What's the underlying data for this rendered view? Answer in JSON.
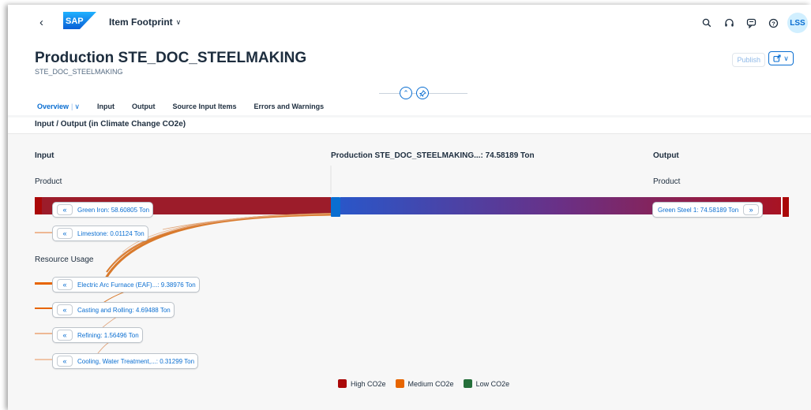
{
  "shell": {
    "logo_text": "SAP",
    "app_title": "Item Footprint",
    "avatar_initials": "LSS"
  },
  "header": {
    "title": "Production STE_DOC_STEELMAKING",
    "subtitle": "STE_DOC_STEELMAKING",
    "publish_label": "Publish"
  },
  "tabs": [
    {
      "label": "Overview"
    },
    {
      "label": "Input"
    },
    {
      "label": "Output"
    },
    {
      "label": "Source Input Items"
    },
    {
      "label": "Errors and Warnings"
    }
  ],
  "section": {
    "title": "Input / Output (in Climate Change CO2e)",
    "input_heading": "Input",
    "center_heading": "Production STE_DOC_STEELMAKING...: 74.58189 Ton",
    "output_heading": "Output",
    "input_product_label": "Product",
    "output_product_label": "Product",
    "resource_usage_label": "Resource Usage"
  },
  "inputs": {
    "products": [
      {
        "label": "Green Iron: 58.60805 Ton",
        "value": 58.60805,
        "level": "high"
      },
      {
        "label": "Limestone: 0.01124 Ton",
        "value": 0.01124,
        "level": "medium"
      }
    ],
    "resources": [
      {
        "label": "Electric Arc Furnace (EAF)...: 9.38976 Ton",
        "value": 9.38976,
        "level": "medium"
      },
      {
        "label": "Casting and Rolling: 4.69488 Ton",
        "value": 4.69488,
        "level": "medium"
      },
      {
        "label": "Refining: 1.56496 Ton",
        "value": 1.56496,
        "level": "medium"
      },
      {
        "label": "Cooling, Water Treatment,...: 0.31299 Ton",
        "value": 0.31299,
        "level": "medium"
      }
    ]
  },
  "outputs": [
    {
      "label": "Green Steel 1: 74.58189 Ton",
      "value": 74.58189,
      "level": "high"
    }
  ],
  "legend": [
    {
      "label": "High CO2e",
      "color": "#aa0808"
    },
    {
      "label": "Medium CO2e",
      "color": "#e76500"
    },
    {
      "label": "Low CO2e",
      "color": "#256f3a"
    }
  ],
  "icons": {
    "back": "chevron-left-icon",
    "search": "search-icon",
    "headset": "headset-icon",
    "chat": "chat-bubble-icon",
    "help": "help-icon",
    "share": "share-icon",
    "collapse": "chevron-up-icon",
    "pin": "pin-icon",
    "nav_back": "double-chevron-left-icon",
    "nav_forward": "double-chevron-right-icon"
  }
}
